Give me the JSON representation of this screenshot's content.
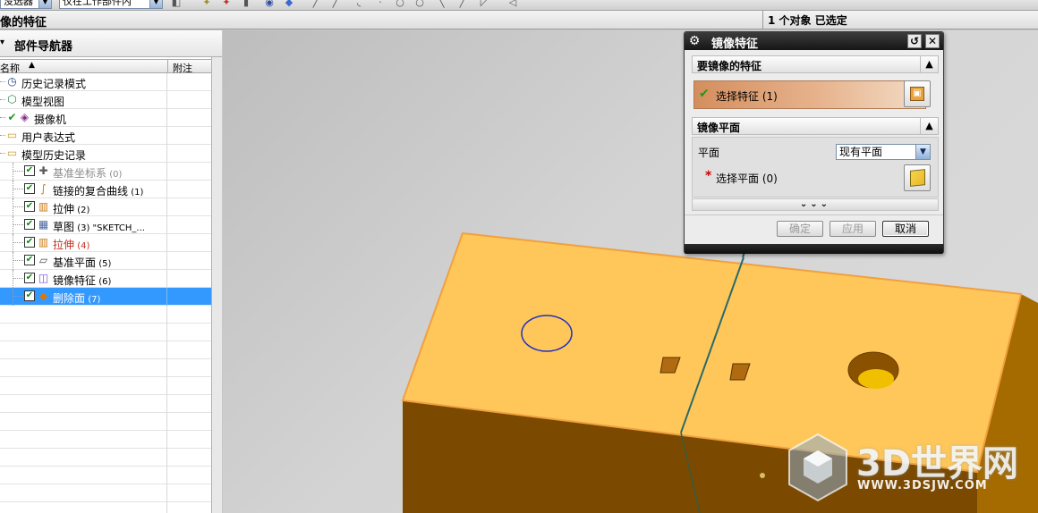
{
  "toolbar": {
    "filter_value": "没选器",
    "scope_value": "仅在工作部件内"
  },
  "statusbar": {
    "prompt": "像的特征",
    "selection_status": "1 个对象  已选定"
  },
  "navigator": {
    "title": "部件导航器",
    "col_name": "名称",
    "col_note": "附注",
    "rows": [
      {
        "label": "历史记录模式",
        "num": "",
        "icon": "clock-icon",
        "color": "#000000"
      },
      {
        "label": "模型视图",
        "num": "",
        "icon": "model-views-icon",
        "color": "#000000"
      },
      {
        "label": "摄像机",
        "num": "",
        "icon": "camera-icon",
        "color": "#000000"
      },
      {
        "label": "用户表达式",
        "num": "",
        "icon": "folder-icon",
        "color": "#000000"
      },
      {
        "label": "模型历史记录",
        "num": "",
        "icon": "folder-open-icon",
        "color": "#000000"
      },
      {
        "label": "基准坐标系",
        "num": "(0)",
        "icon": "datum-csys-icon",
        "color": "#8a8a8a"
      },
      {
        "label": "链接的复合曲线",
        "num": "(1)",
        "icon": "composite-curve-icon",
        "color": "#000000"
      },
      {
        "label": "拉伸",
        "num": "(2)",
        "icon": "extrude-icon",
        "color": "#000000"
      },
      {
        "label": "草图",
        "num": "(3) \"SKETCH_...",
        "icon": "sketch-icon",
        "color": "#000000"
      },
      {
        "label": "拉伸",
        "num": "(4)",
        "icon": "extrude-icon",
        "color": "#c03020"
      },
      {
        "label": "基准平面",
        "num": "(5)",
        "icon": "datum-plane-icon",
        "color": "#000000"
      },
      {
        "label": "镜像特征",
        "num": "(6)",
        "icon": "mirror-feature-icon",
        "color": "#000000"
      },
      {
        "label": "删除面",
        "num": "(7)",
        "icon": "delete-face-icon",
        "color": "#ffffff"
      }
    ]
  },
  "dialog": {
    "title": "镜像特征",
    "section_features": "要镜像的特征",
    "select_features": "选择特征 (1)",
    "section_plane": "镜像平面",
    "plane_label": "平面",
    "plane_option": "现有平面",
    "select_plane": "选择平面 (0)",
    "ok": "确定",
    "apply": "应用",
    "cancel": "取消"
  },
  "watermark": {
    "main": "3D世界网",
    "sub": "WWW.3DSJW.COM"
  },
  "colors": {
    "selection": "#3399ff",
    "solid_top": "#ffc85a",
    "solid_side": "#7a4800",
    "dialog_title": "#1e1e1e"
  }
}
